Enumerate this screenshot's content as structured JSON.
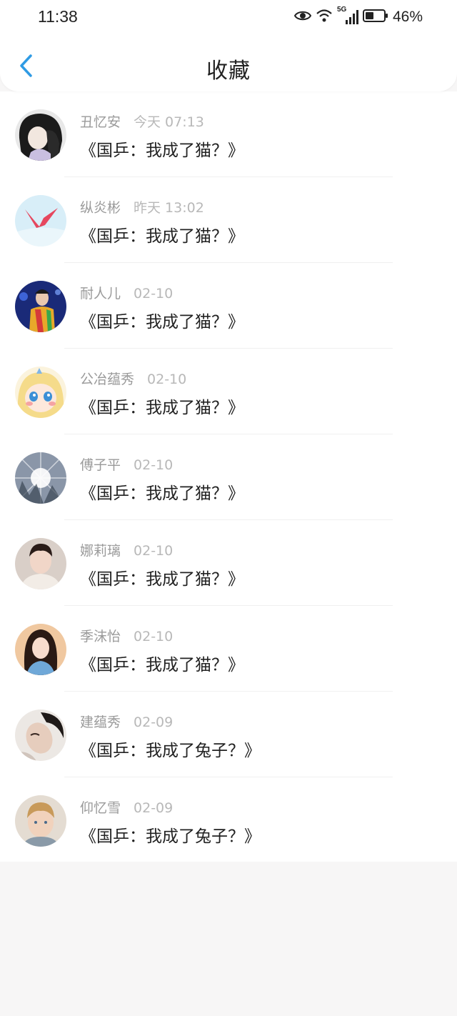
{
  "status_bar": {
    "time": "11:38",
    "battery_percent": "46%",
    "network_label": "5G",
    "icons": [
      "eye-icon",
      "wifi-icon",
      "signal-icon",
      "battery-icon"
    ]
  },
  "nav": {
    "title": "收藏",
    "back_icon": "chevron-left-icon"
  },
  "colors": {
    "accent": "#2f9be4",
    "title_text": "#222222",
    "meta_text": "#9a9a9a",
    "time_text": "#b8b8b8",
    "page_background": "#f7f6f6"
  },
  "favorites": [
    {
      "name": "丑忆安",
      "time": "今天 07:13",
      "title": "《国乒：我成了猫？》",
      "avatar": "avatar-1"
    },
    {
      "name": "纵炎彬",
      "time": "昨天 13:02",
      "title": "《国乒：我成了猫？》",
      "avatar": "avatar-2"
    },
    {
      "name": "耐人儿",
      "time": "02-10",
      "title": "《国乒：我成了猫？》",
      "avatar": "avatar-3"
    },
    {
      "name": "公冶蕴秀",
      "time": "02-10",
      "title": "《国乒：我成了猫？》",
      "avatar": "avatar-4"
    },
    {
      "name": "傅子平",
      "time": "02-10",
      "title": "《国乒：我成了猫？》",
      "avatar": "avatar-5"
    },
    {
      "name": "娜莉璃",
      "time": "02-10",
      "title": "《国乒：我成了猫？》",
      "avatar": "avatar-6"
    },
    {
      "name": "季沫怡",
      "time": "02-10",
      "title": "《国乒：我成了猫？》",
      "avatar": "avatar-7"
    },
    {
      "name": "建蕴秀",
      "time": "02-09",
      "title": "《国乒：我成了兔子？》",
      "avatar": "avatar-8"
    },
    {
      "name": "仰忆雪",
      "time": "02-09",
      "title": "《国乒：我成了兔子？》",
      "avatar": "avatar-9"
    }
  ]
}
